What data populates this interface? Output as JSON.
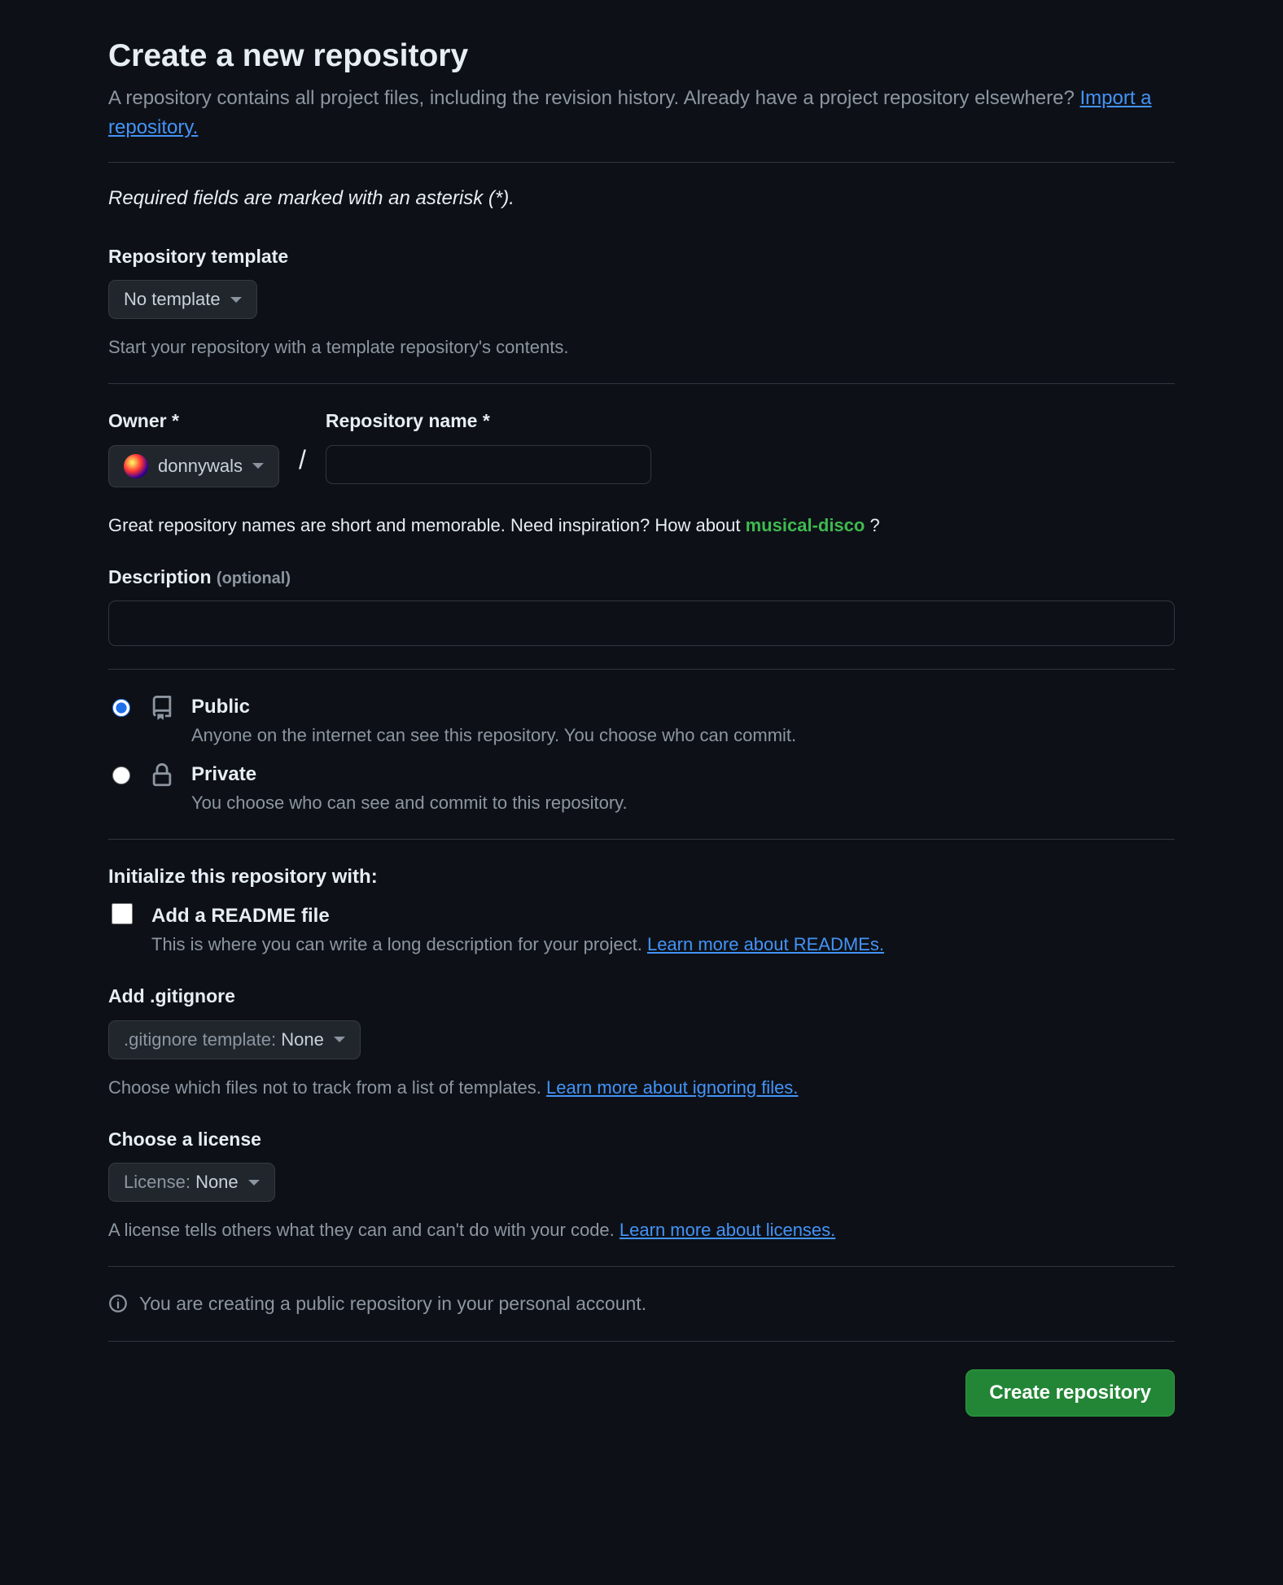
{
  "header": {
    "title": "Create a new repository",
    "subtitle_prefix": "A repository contains all project files, including the revision history. Already have a project repository elsewhere? ",
    "import_link": "Import a repository.",
    "required_note": "Required fields are marked with an asterisk (*)."
  },
  "template": {
    "label": "Repository template",
    "selected": "No template",
    "hint": "Start your repository with a template repository's contents."
  },
  "owner": {
    "label": "Owner *",
    "selected": "donnywals"
  },
  "repo_name": {
    "label": "Repository name *",
    "value": ""
  },
  "name_hint": {
    "prefix": "Great repository names are short and memorable. Need inspiration? How about ",
    "suggestion": "musical-disco",
    "suffix": " ?"
  },
  "description": {
    "label": "Description",
    "optional": "(optional)",
    "value": ""
  },
  "visibility": {
    "public": {
      "title": "Public",
      "desc": "Anyone on the internet can see this repository. You choose who can commit.",
      "selected": true
    },
    "private": {
      "title": "Private",
      "desc": "You choose who can see and commit to this repository.",
      "selected": false
    }
  },
  "initialize": {
    "heading": "Initialize this repository with:",
    "readme": {
      "title": "Add a README file",
      "desc_prefix": "This is where you can write a long description for your project. ",
      "learn_more": "Learn more about READMEs."
    },
    "gitignore": {
      "label": "Add .gitignore",
      "prefix": ".gitignore template: ",
      "selected": "None",
      "hint_prefix": "Choose which files not to track from a list of templates. ",
      "learn_more": "Learn more about ignoring files."
    },
    "license": {
      "label": "Choose a license",
      "prefix": "License: ",
      "selected": "None",
      "hint_prefix": "A license tells others what they can and can't do with your code. ",
      "learn_more": "Learn more about licenses."
    }
  },
  "footer": {
    "info": "You are creating a public repository in your personal account.",
    "submit": "Create repository"
  }
}
